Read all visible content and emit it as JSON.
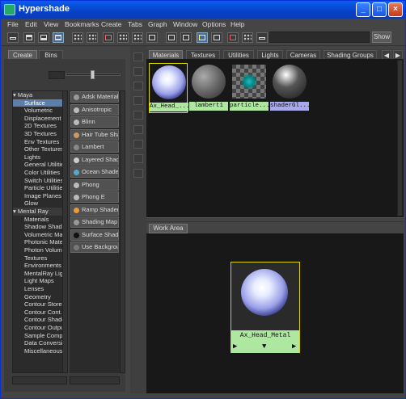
{
  "window": {
    "title": "Hypershade",
    "controls": [
      "_",
      "□",
      "×"
    ]
  },
  "menu": {
    "items": [
      "File",
      "Edit",
      "View",
      "Bookmarks",
      "Create",
      "Tabs",
      "Graph",
      "Window",
      "Options",
      "Help"
    ]
  },
  "toolbar": {
    "show_label": "Show",
    "search_value": ""
  },
  "create_tabs": {
    "tabs": [
      "Create",
      "Bins"
    ],
    "active": "Create"
  },
  "tree": {
    "maya_header": "Maya",
    "maya_items": [
      "Surface",
      "Volumetric",
      "Displacement",
      "2D Textures",
      "3D Textures",
      "Env Textures",
      "Other Textures",
      "Lights",
      "General Utilities",
      "Color Utilities",
      "Switch Utilities",
      "Particle Utilities",
      "Image Planes",
      "Glow"
    ],
    "selected": "Surface",
    "mr_header": "Mental Ray",
    "mr_items": [
      "Materials",
      "Shadow Shad...",
      "Volumetric Ma...",
      "Photonic Mate...",
      "Photon Volum...",
      "Textures",
      "Environments",
      "MentalRay Lig...",
      "Light Maps",
      "Lenses",
      "Geometry",
      "Contour Store",
      "Contour Cont...",
      "Contour Shade",
      "Contour Output",
      "Sample Comp...",
      "Data Conversi...",
      "Miscellaneous"
    ]
  },
  "nodes": {
    "items": [
      "Adsk Material",
      "Anisotropic",
      "Blinn",
      "Hair Tube Shader",
      "Lambert",
      "Layered Shader",
      "Ocean Shader",
      "Phong",
      "Phong E",
      "Ramp Shader",
      "Shading Map",
      "Surface Shader",
      "Use Background"
    ]
  },
  "top_tabs": {
    "tabs": [
      "Materials",
      "Textures",
      "Utilities",
      "Lights",
      "Cameras",
      "Shading Groups"
    ],
    "active": "Materials"
  },
  "materials": {
    "swatches": [
      {
        "label": "Ax_Head_...",
        "kind": "metal",
        "selected": true
      },
      {
        "label": "lambert1",
        "kind": "lambert",
        "selected": false
      },
      {
        "label": "particle...",
        "kind": "particle",
        "selected": false
      },
      {
        "label": "shaderGl...",
        "kind": "glass",
        "selected": false
      }
    ]
  },
  "work_area": {
    "tab_label": "Work Area",
    "node_label": "Ax_Head_Metal",
    "arrows": [
      "▶",
      "▼",
      "▶"
    ]
  }
}
